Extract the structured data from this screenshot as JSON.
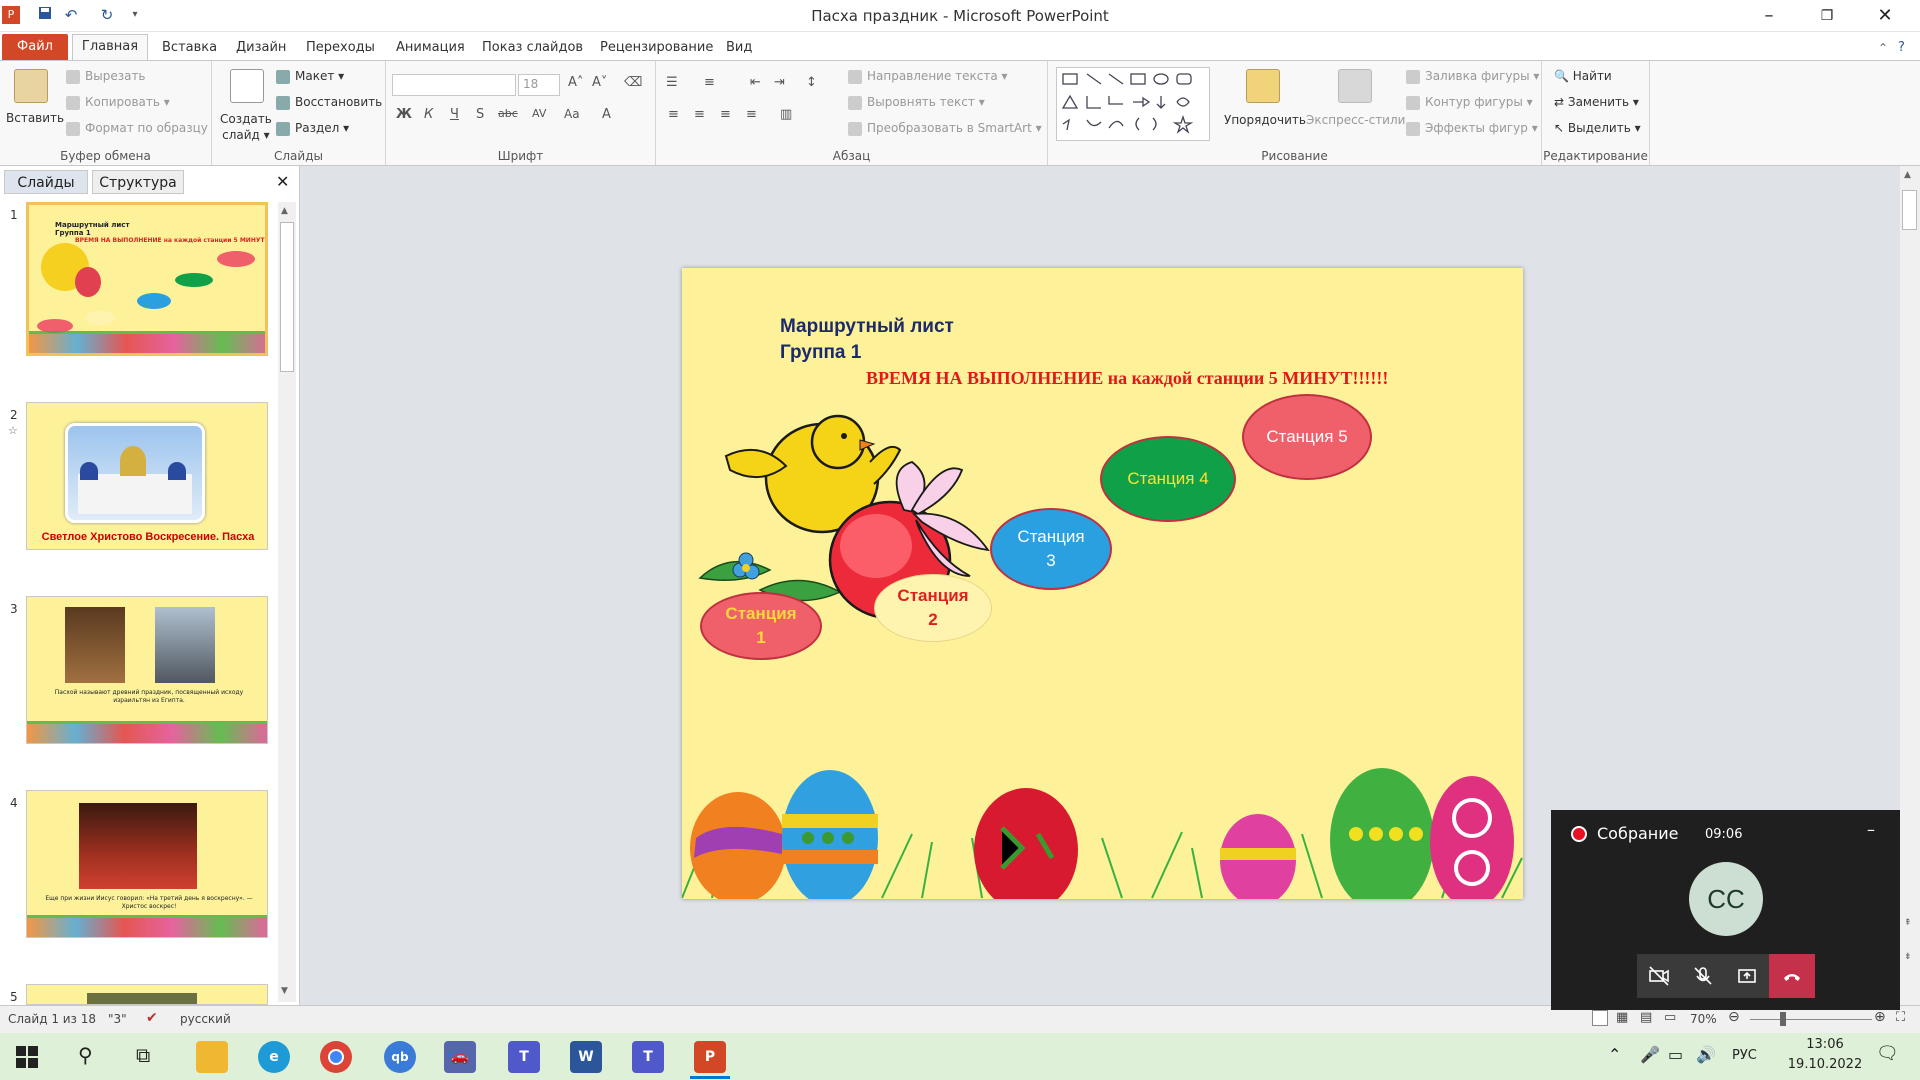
{
  "window": {
    "title": "Пасха праздник - Microsoft PowerPoint",
    "qat_icons": [
      "powerpoint-logo-icon",
      "save-icon",
      "undo-icon",
      "redo-icon",
      "customize-icon"
    ],
    "controls": [
      "minimize-icon",
      "restore-icon",
      "close-icon"
    ]
  },
  "tabs": [
    "Файл",
    "Главная",
    "Вставка",
    "Дизайн",
    "Переходы",
    "Анимация",
    "Показ слайдов",
    "Рецензирование",
    "Вид"
  ],
  "ribbon": {
    "clipboard": {
      "label": "Буфер обмена",
      "paste": "Вставить",
      "cut": "Вырезать",
      "copy": "Копировать",
      "format_painter": "Формат по образцу"
    },
    "slides": {
      "label": "Слайды",
      "new_slide": "Создать слайд",
      "new_slide_line1": "Создать",
      "new_slide_line2": "слайд",
      "layout": "Макет",
      "reset": "Восстановить",
      "section": "Раздел"
    },
    "font": {
      "label": "Шрифт",
      "font_name": "",
      "font_size": "18",
      "buttons": [
        "Ж",
        "К",
        "Ч",
        "S",
        "abc",
        "AV",
        "Aa",
        "A"
      ]
    },
    "paragraph": {
      "label": "Абзац",
      "text_direction": "Направление текста",
      "align_text": "Выровнять текст",
      "smartart": "Преобразовать в SmartArt"
    },
    "drawing": {
      "label": "Рисование",
      "arrange": "Упорядочить",
      "quick_styles": "Экспресс-стили",
      "shape_fill": "Заливка фигуры",
      "shape_outline": "Контур фигуры",
      "shape_effects": "Эффекты фигур"
    },
    "editing": {
      "label": "Редактирование",
      "find": "Найти",
      "replace": "Заменить",
      "select": "Выделить"
    }
  },
  "panel": {
    "tab_slides": "Слайды",
    "tab_outline": "Структура",
    "thumbnails": [
      {
        "num": "1",
        "caption": ""
      },
      {
        "num": "2",
        "caption": "Светлое Христово Воскресение. Пасха"
      },
      {
        "num": "3",
        "caption": "Пасхой называют древний праздник, посвященный исходу израильтян из Египта."
      },
      {
        "num": "4",
        "caption": "Еще при жизни Иисус говорил: «На третий день я воскресну». — Христос воскрес!"
      },
      {
        "num": "5",
        "caption": ""
      }
    ]
  },
  "slide": {
    "heading1": "Маршрутный лист",
    "heading2": "Группа 1",
    "banner": "ВРЕМЯ НА ВЫПОЛНЕНИЕ на каждой станции 5 МИНУТ!!!!!!",
    "stations": [
      {
        "line1": "Станция",
        "line2": "1",
        "fill": "#f0606a",
        "text": "#ffd83a"
      },
      {
        "line1": "Станция",
        "line2": "2",
        "fill": "#fff3b0",
        "text": "#e02020"
      },
      {
        "line1": "Станция",
        "line2": "3",
        "fill": "#2aa0e0",
        "text": "#ffffff"
      },
      {
        "line1": "Станция 4",
        "line2": "",
        "fill": "#10a048",
        "text": "#ffe030"
      },
      {
        "line1": "Станция 5",
        "line2": "",
        "fill": "#f0606a",
        "text": "#ffffff"
      }
    ]
  },
  "status": {
    "slide_info": "Слайд 1 из 18",
    "theme": "\"3\"",
    "language": "русский",
    "zoom": "70%"
  },
  "meeting": {
    "title": "Собрание",
    "time": "09:06",
    "avatar": "CC"
  },
  "taskbar": {
    "lang": "РУС",
    "time": "13:06",
    "date": "19.10.2022"
  }
}
